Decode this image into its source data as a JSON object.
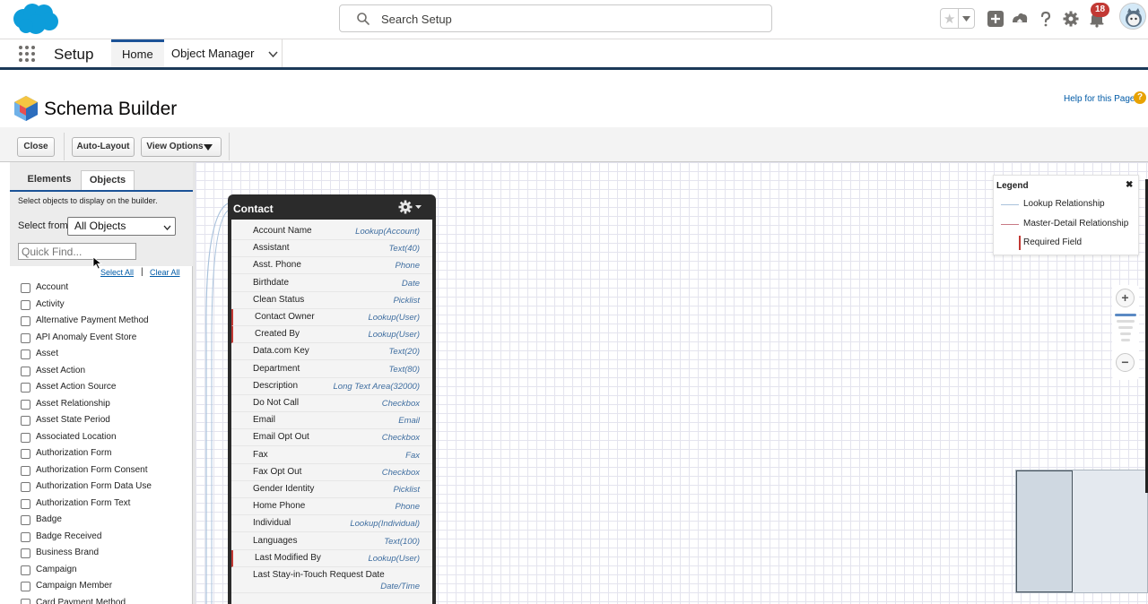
{
  "header": {
    "search_placeholder": "Search Setup",
    "notification_count": "18"
  },
  "nav": {
    "app_name": "Setup",
    "tabs": [
      {
        "label": "Home",
        "active": true
      },
      {
        "label": "Object Manager",
        "active": false
      }
    ]
  },
  "page": {
    "title": "Schema Builder",
    "help_link": "Help for this Page"
  },
  "toolbar": {
    "close_label": "Close",
    "auto_layout_label": "Auto-Layout",
    "view_options_label": "View Options"
  },
  "sidebar": {
    "tabs": [
      {
        "label": "Elements",
        "active": false
      },
      {
        "label": "Objects",
        "active": true
      }
    ],
    "hint": "Select objects to display on the builder.",
    "select_label": "Select from",
    "select_value": "All Objects",
    "quick_find_placeholder": "Quick Find...",
    "select_all_label": "Select All",
    "separator": "|",
    "clear_all_label": "Clear All",
    "objects": [
      "Account",
      "Activity",
      "Alternative Payment Method",
      "API Anomaly Event Store",
      "Asset",
      "Asset Action",
      "Asset Action Source",
      "Asset Relationship",
      "Asset State Period",
      "Associated Location",
      "Authorization Form",
      "Authorization Form Consent",
      "Authorization Form Data Use",
      "Authorization Form Text",
      "Badge",
      "Badge Received",
      "Business Brand",
      "Campaign",
      "Campaign Member",
      "Card Payment Method"
    ]
  },
  "contact_card": {
    "title": "Contact",
    "fields": [
      {
        "name": "Account Name",
        "type": "Lookup(Account)",
        "required": false
      },
      {
        "name": "Assistant",
        "type": "Text(40)",
        "required": false
      },
      {
        "name": "Asst. Phone",
        "type": "Phone",
        "required": false
      },
      {
        "name": "Birthdate",
        "type": "Date",
        "required": false
      },
      {
        "name": "Clean Status",
        "type": "Picklist",
        "required": false
      },
      {
        "name": "Contact Owner",
        "type": "Lookup(User)",
        "required": true
      },
      {
        "name": "Created By",
        "type": "Lookup(User)",
        "required": true
      },
      {
        "name": "Data.com Key",
        "type": "Text(20)",
        "required": false
      },
      {
        "name": "Department",
        "type": "Text(80)",
        "required": false
      },
      {
        "name": "Description",
        "type": "Long Text Area(32000)",
        "required": false
      },
      {
        "name": "Do Not Call",
        "type": "Checkbox",
        "required": false
      },
      {
        "name": "Email",
        "type": "Email",
        "required": false
      },
      {
        "name": "Email Opt Out",
        "type": "Checkbox",
        "required": false
      },
      {
        "name": "Fax",
        "type": "Fax",
        "required": false
      },
      {
        "name": "Fax Opt Out",
        "type": "Checkbox",
        "required": false
      },
      {
        "name": "Gender Identity",
        "type": "Picklist",
        "required": false
      },
      {
        "name": "Home Phone",
        "type": "Phone",
        "required": false
      },
      {
        "name": "Individual",
        "type": "Lookup(Individual)",
        "required": false
      },
      {
        "name": "Languages",
        "type": "Text(100)",
        "required": false
      },
      {
        "name": "Last Modified By",
        "type": "Lookup(User)",
        "required": true
      },
      {
        "name": "Last Stay-in-Touch Request Date",
        "type": "Date/Time",
        "required": false
      }
    ]
  },
  "legend": {
    "title": "Legend",
    "close": "✖",
    "items": [
      {
        "label": "Lookup Relationship",
        "color": "#a9c2dc"
      },
      {
        "label": "Master-Detail Relationship",
        "color": "#c97a85"
      },
      {
        "label": "Required Field",
        "color": "#c23934"
      }
    ]
  },
  "zoom": {
    "in": "+",
    "out": "−"
  },
  "colors": {
    "brand_blue": "#1b5297",
    "link_blue": "#015ba7",
    "required_red": "#c23934",
    "card_dark": "#2b2b2b"
  }
}
